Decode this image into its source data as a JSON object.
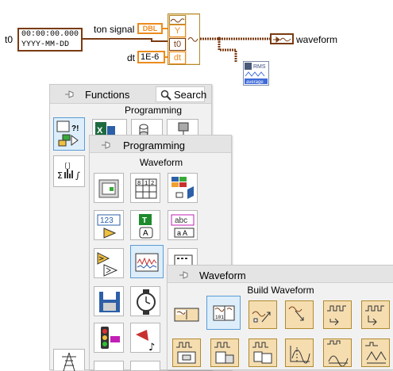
{
  "block_diagram": {
    "t0_label": "t0",
    "t0_time": "00:00:00.000",
    "t0_format": "YYYY-MM-DD",
    "ton_signal_label": "ton signal",
    "ton_signal_type": "DBL",
    "dt_label": "dt",
    "dt_value": "1E-6",
    "build_waveform_inputs": [
      "Y",
      "t0",
      "dt"
    ],
    "waveform_label": "waveform",
    "rms_node_text": [
      "RMS",
      "average"
    ]
  },
  "functions_palette": {
    "title": "Functions",
    "search_label": "Search",
    "subtitle": "Programming"
  },
  "programming_palette": {
    "title": "Programming",
    "subtitle": "Waveform"
  },
  "waveform_palette": {
    "title": "Waveform",
    "subtitle": "Build Waveform"
  },
  "colors": {
    "waveform_wire": "#7a3b12",
    "numeric_wire": "#ec8b1d",
    "selection": "#5b9bd5"
  }
}
